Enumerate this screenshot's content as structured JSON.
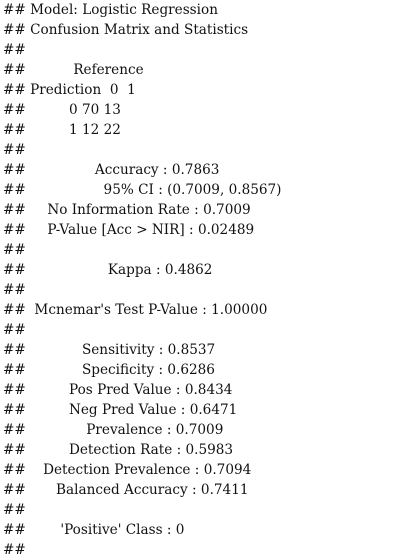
{
  "console": {
    "prefix": "##",
    "lines": [
      " Model: Logistic Regression",
      " Confusion Matrix and Statistics",
      "",
      "           Reference",
      " Prediction  0  1",
      "          0 70 13",
      "          1 12 22",
      "",
      "                Accuracy : 0.7863",
      "                  95% CI : (0.7009, 0.8567)",
      "     No Information Rate : 0.7009",
      "     P-Value [Acc > NIR] : 0.02489",
      "",
      "                   Kappa : 0.4862",
      "",
      "  Mcnemar's Test P-Value : 1.00000",
      "",
      "             Sensitivity : 0.8537",
      "             Specificity : 0.6286",
      "          Pos Pred Value : 0.8434",
      "          Neg Pred Value : 0.6471",
      "              Prevalence : 0.7009",
      "          Detection Rate : 0.5983",
      "    Detection Prevalence : 0.7094",
      "       Balanced Accuracy : 0.7411",
      "",
      "        'Positive' Class : 0",
      ""
    ]
  }
}
